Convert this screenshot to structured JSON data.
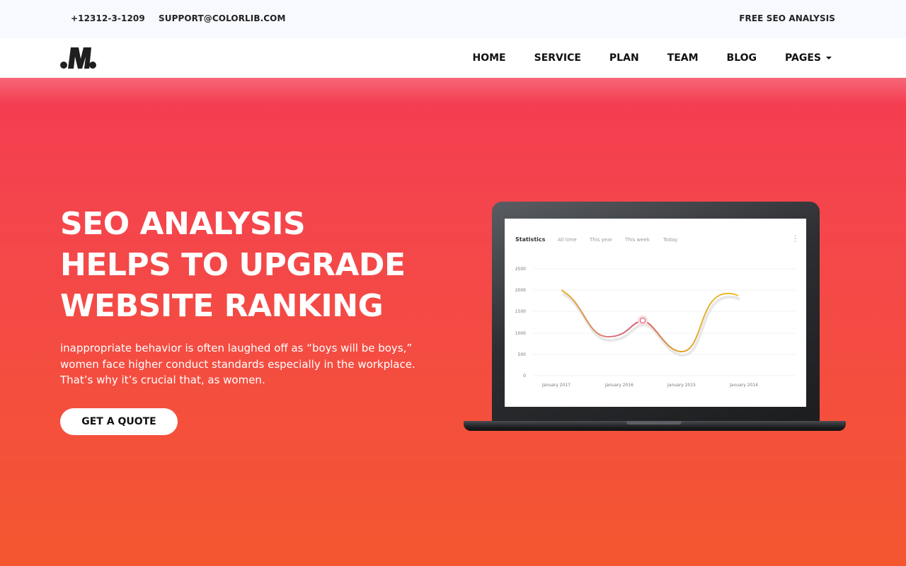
{
  "topbar": {
    "phone": "+12312-3-1209",
    "email": "SUPPORT@COLORLIB.COM",
    "free_seo": "FREE SEO ANALYSIS"
  },
  "nav": {
    "items": [
      "HOME",
      "SERVICE",
      "PLAN",
      "TEAM",
      "BLOG",
      "PAGES"
    ]
  },
  "hero": {
    "headline_lines": [
      "SEO ANALYSIS",
      "HELPS TO UPGRADE",
      "WEBSITE RANKING"
    ],
    "description": "inappropriate behavior is often laughed off as “boys will be boys,” women face higher conduct standards especially in the workplace. That’s why it’s crucial that, as women.",
    "cta_label": "GET A QUOTE"
  },
  "dashboard": {
    "title": "Statistics",
    "tabs": [
      "All time",
      "This year",
      "This week",
      "Today"
    ],
    "y_ticks": [
      "2500",
      "2000",
      "1500",
      "1000",
      "500",
      "0"
    ],
    "x_ticks": [
      "January 2017",
      "January 2016",
      "January 2015",
      "January 2014"
    ]
  },
  "colors": {
    "hero_top": "#f43c52",
    "hero_bottom": "#f45730",
    "topbar_bg": "#f8f9ff"
  }
}
